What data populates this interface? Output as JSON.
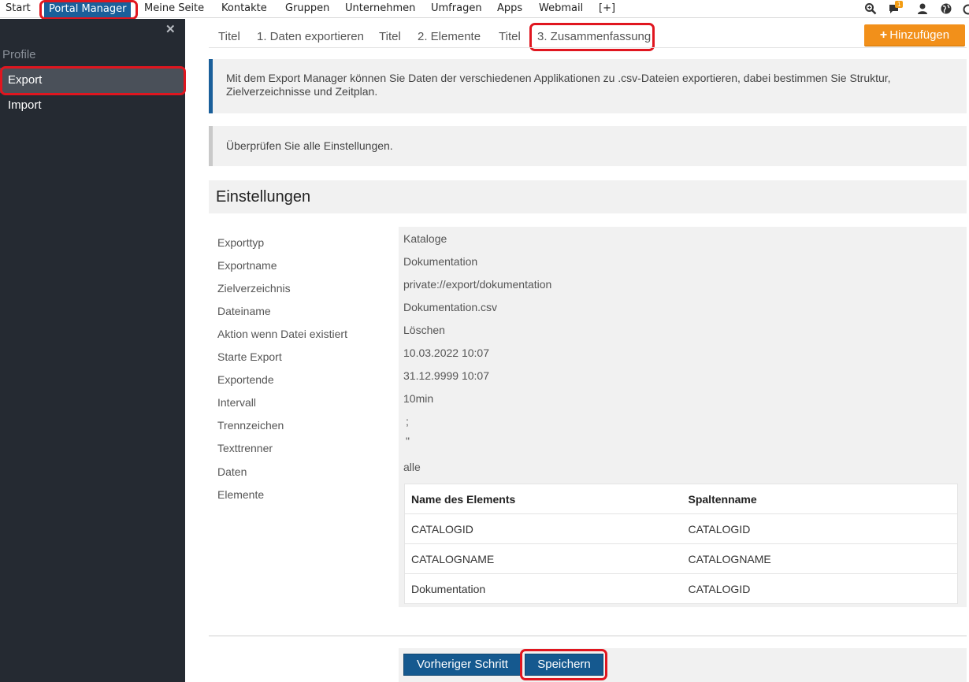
{
  "topnav": {
    "items": [
      "Start",
      "Portal Manager",
      "Meine Seite",
      "Kontakte",
      "Gruppen",
      "Unternehmen",
      "Umfragen",
      "Apps",
      "Webmail",
      "[+]"
    ],
    "active": "Portal Manager",
    "notifications_badge": "1",
    "icons": [
      "search-icon",
      "chat-icon",
      "user-icon",
      "globe-icon"
    ]
  },
  "sidebar": {
    "close_symbol": "✕",
    "heading": "Profile",
    "items": [
      {
        "label": "Export",
        "active": true
      },
      {
        "label": "Import",
        "active": false
      }
    ]
  },
  "tabs": [
    "Titel",
    "1. Daten exportieren",
    "Titel",
    "2. Elemente",
    "Titel",
    "3. Zusammenfassung"
  ],
  "add_button": {
    "label": "Hinzufügen",
    "color": "#f2901a"
  },
  "info": {
    "text": "Mit dem Export Manager können Sie Daten der verschiedenen Applikationen zu .csv-Dateien exportieren, dabei bestimmen Sie Struktur, Zielverzeichnisse und Zeitplan.",
    "check": "Überprüfen Sie alle Einstellungen."
  },
  "settings": {
    "title": "Einstellungen",
    "labels": [
      "Exporttyp",
      "Exportname",
      "Zielverzeichnis",
      "Dateiname",
      "Aktion wenn Datei existiert",
      "Starte Export",
      "Exportende",
      "Intervall",
      "Trennzeichen",
      "Texttrenner",
      "Daten",
      "Elemente"
    ],
    "values": [
      "Kataloge",
      "Dokumentation",
      "private://export/dokumentation",
      "Dokumentation.csv",
      "Löschen",
      "10.03.2022 10:07",
      "31.12.9999 10:07",
      "10min",
      ";",
      "\"",
      "alle"
    ]
  },
  "elements_table": {
    "headers": [
      "Name des Elements",
      "Spaltenname"
    ],
    "rows": [
      [
        "CATALOGID",
        "CATALOGID"
      ],
      [
        "CATALOGNAME",
        "CATALOGNAME"
      ],
      [
        "Dokumentation",
        "CATALOGID"
      ]
    ]
  },
  "footer": {
    "prev_label": "Vorheriger Schritt",
    "save_label": "Speichern"
  },
  "colors": {
    "accent": "#1a5f9a",
    "sidebar": "#252a32",
    "highlight": "#e0161f",
    "orange": "#f2901a"
  }
}
